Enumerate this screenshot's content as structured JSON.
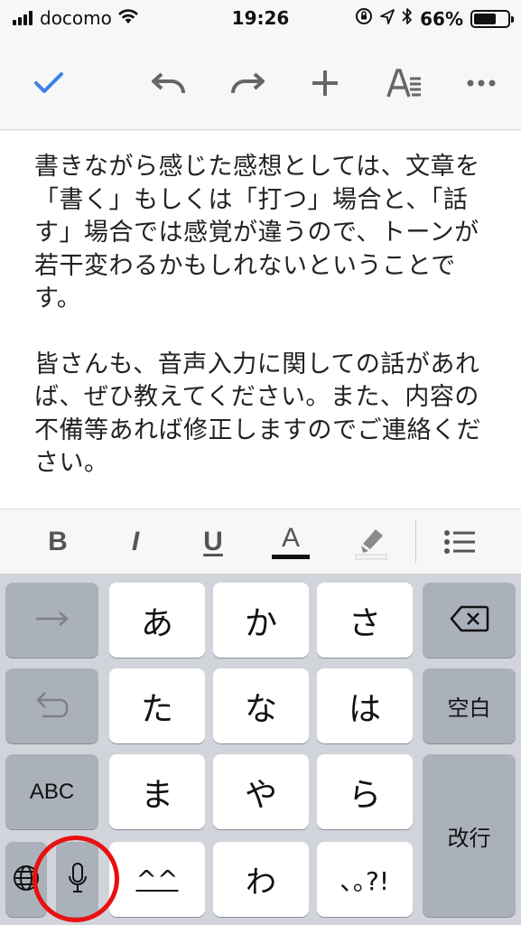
{
  "status_bar": {
    "carrier": "docomo",
    "time": "19:26",
    "battery_percent": "66%",
    "battery_level": 0.66,
    "icons": [
      "signal-icon",
      "wifi-icon",
      "orientation-lock-icon",
      "location-icon",
      "bluetooth-icon",
      "battery-icon"
    ]
  },
  "toolbar": {
    "icons": [
      "checkmark-icon",
      "undo-icon",
      "redo-icon",
      "add-icon",
      "text-format-icon",
      "more-icon"
    ],
    "accent": "#3b82e6"
  },
  "document": {
    "paragraphs": [
      "書きながら感じた感想としては、文章を「書く」もしくは「打つ」場合と、「話す」場合では感覚が違うので、トーンが若干変わるかもしれないということです。",
      "皆さんも、音声入力に関しての話があれば、ぜひ教えてください。また、内容の不備等あれば修正しますのでご連絡ください。"
    ]
  },
  "format_bar": {
    "bold": "B",
    "italic": "I",
    "underline": "U",
    "text_color": "A",
    "icons": [
      "bold-icon",
      "italic-icon",
      "underline-icon",
      "text-color-icon",
      "highlight-icon",
      "bulleted-list-icon"
    ]
  },
  "keyboard": {
    "row1": [
      "あ",
      "か",
      "さ"
    ],
    "row2": [
      "た",
      "な",
      "は"
    ],
    "row3": [
      "ま",
      "や",
      "ら"
    ],
    "row4": [
      "^^",
      "わ",
      "､｡?!"
    ],
    "space_label": "空白",
    "abc_label": "ABC",
    "return_label": "改行",
    "icons": [
      "next-arrow-icon",
      "undo-icon",
      "globe-icon",
      "microphone-icon",
      "delete-icon"
    ]
  },
  "annotation": {
    "color": "#e81010"
  }
}
